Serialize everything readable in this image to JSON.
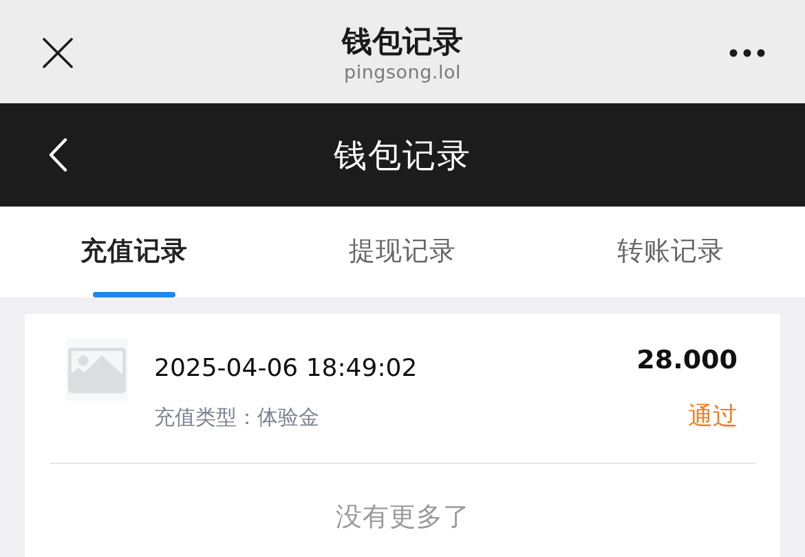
{
  "browser_bar": {
    "title": "钱包记录",
    "domain": "pingsong.lol"
  },
  "header": {
    "title": "钱包记录"
  },
  "tabs": [
    {
      "label": "充值记录",
      "selected": true
    },
    {
      "label": "提现记录",
      "selected": false
    },
    {
      "label": "转账记录",
      "selected": false
    }
  ],
  "records": [
    {
      "time": "2025-04-06 18:49:02",
      "type": "充值类型：体验金",
      "amount": "28.000",
      "status": "通过",
      "color": "#f47d22"
    }
  ],
  "footer_note": "没有更多了"
}
